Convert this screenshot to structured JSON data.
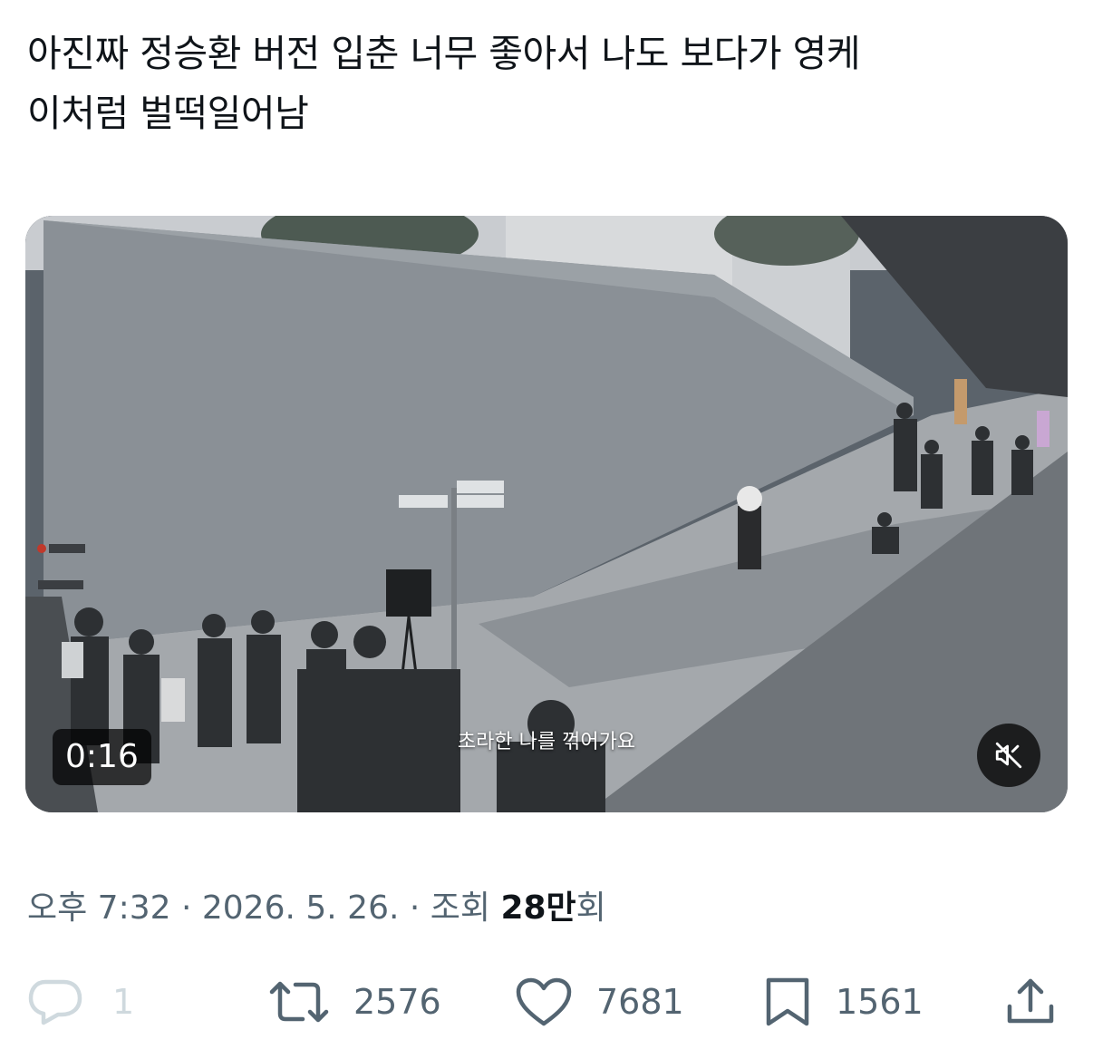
{
  "tweet": {
    "text": "아진짜 정승환 버전 입춘 너무 좋아서 나도 보다가 영케\n이처럼 벌떡일어남"
  },
  "media": {
    "caption": "초라한 나를 꺾어가요",
    "duration": "0:16",
    "mute_icon": "speaker-muted-icon"
  },
  "meta": {
    "time": "오후 7:32",
    "separator": " · ",
    "date": "2026. 5. 26.",
    "views_label": "조회 ",
    "views_count": "28만",
    "views_suffix": "회"
  },
  "actions": {
    "reply": {
      "icon": "reply-icon",
      "count": "1"
    },
    "retweet": {
      "icon": "retweet-icon",
      "count": "2576"
    },
    "like": {
      "icon": "heart-icon",
      "count": "7681"
    },
    "bookmark": {
      "icon": "bookmark-icon",
      "count": "1561"
    },
    "share": {
      "icon": "share-icon"
    }
  },
  "colors": {
    "text_primary": "#0f1419",
    "text_secondary": "#536471",
    "reply_disabled": "#cfd9de"
  }
}
